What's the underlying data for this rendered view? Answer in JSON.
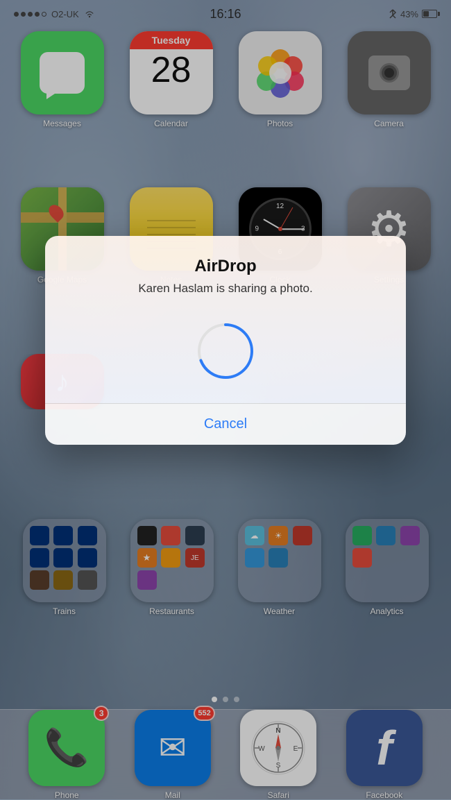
{
  "statusBar": {
    "carrier": "O2-UK",
    "time": "16:16",
    "battery": "43%",
    "batteryPercent": 43
  },
  "row1": {
    "apps": [
      {
        "id": "messages",
        "label": "Messages"
      },
      {
        "id": "calendar",
        "label": "Calendar",
        "day": "Tuesday",
        "date": "28"
      },
      {
        "id": "photos",
        "label": "Photos"
      },
      {
        "id": "camera",
        "label": "Camera"
      }
    ]
  },
  "row2": {
    "apps": [
      {
        "id": "maps",
        "label": "Google Maps"
      },
      {
        "id": "notes",
        "label": "Notes"
      },
      {
        "id": "clock",
        "label": "Clock"
      },
      {
        "id": "settings",
        "label": "Settings"
      }
    ]
  },
  "row3": {
    "apps": [
      {
        "id": "itunes",
        "label": "iTunes"
      }
    ]
  },
  "folderRow": {
    "folders": [
      {
        "id": "trains",
        "label": "Trains"
      },
      {
        "id": "restaurants",
        "label": "Restaurants"
      },
      {
        "id": "weather",
        "label": "Weather"
      },
      {
        "id": "analytics",
        "label": "Analytics"
      }
    ]
  },
  "pageIndicators": {
    "dots": [
      {
        "active": true
      },
      {
        "active": false
      },
      {
        "active": false
      }
    ]
  },
  "dock": {
    "apps": [
      {
        "id": "phone",
        "label": "Phone",
        "badge": "3"
      },
      {
        "id": "mail",
        "label": "Mail",
        "badge": "552"
      },
      {
        "id": "safari",
        "label": "Safari"
      },
      {
        "id": "facebook",
        "label": "Facebook"
      }
    ]
  },
  "modal": {
    "title": "AirDrop",
    "subtitle": "Karen Haslam is sharing a photo.",
    "cancelLabel": "Cancel"
  }
}
